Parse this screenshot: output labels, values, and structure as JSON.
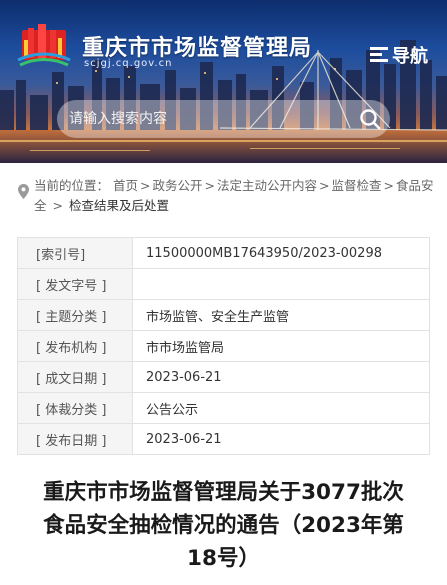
{
  "header": {
    "site_title": "重庆市市场监督管理局",
    "site_domain": "scjgj.cq.gov.cn",
    "nav_label": "导航",
    "search_placeholder": "请输入搜索内容"
  },
  "breadcrumb": {
    "prefix": "当前的位置：",
    "items": [
      "首页",
      "政务公开",
      "法定主动公开内容",
      "监督检查",
      "食品安全"
    ],
    "current": "检查结果及后处置"
  },
  "info": [
    {
      "key": "[索引号]",
      "value": "11500000MB17643950/2023-00298"
    },
    {
      "key": "[ 发文字号 ]",
      "value": ""
    },
    {
      "key": "[ 主题分类 ]",
      "value": "市场监管、安全生产监管"
    },
    {
      "key": "[ 发布机构 ]",
      "value": "市市场监管局"
    },
    {
      "key": "[ 成文日期 ]",
      "value": "2023-06-21"
    },
    {
      "key": "[ 体裁分类 ]",
      "value": "公告公示"
    },
    {
      "key": "[ 发布日期 ]",
      "value": "2023-06-21"
    }
  ],
  "article": {
    "title_line1": "重庆市市场监督管理局关于3077批次",
    "title_line2": "食品安全抽检情况的通告（2023年第",
    "title_line3": "18号）"
  }
}
